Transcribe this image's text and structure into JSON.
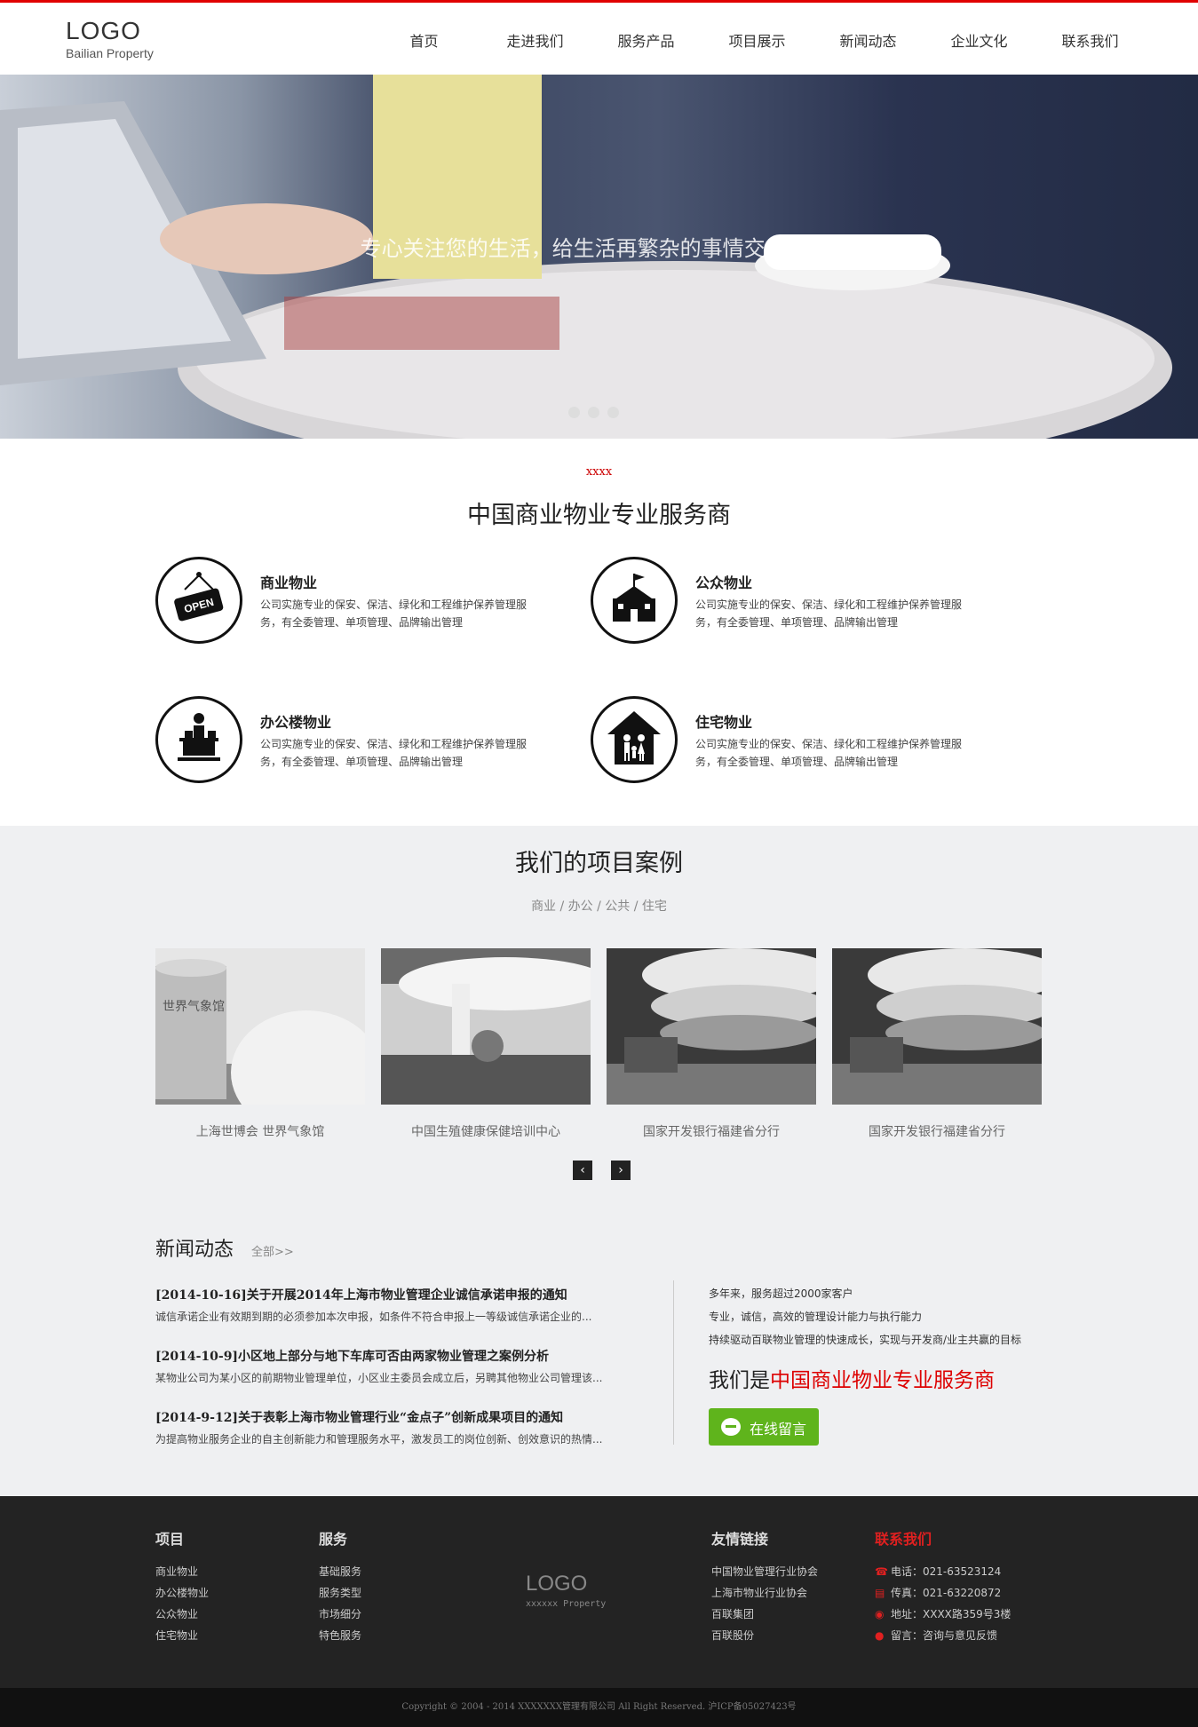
{
  "header": {
    "logo": "LOGO",
    "logo_sub": "Bailian Property",
    "nav": [
      "首页",
      "走进我们",
      "服务产品",
      "项目展示",
      "新闻动态",
      "企业文化",
      "联系我们"
    ]
  },
  "hero": {
    "caption": "专心关注您的生活，给生活再繁杂的事情交给我们!",
    "slide_count": 3
  },
  "intro": {
    "tag": "xxxx",
    "title": "中国商业物业专业服务商"
  },
  "services": [
    {
      "title": "商业物业",
      "desc": "公司实施专业的保安、保洁、绿化和工程维护保养管理服务，有全委管理、单项管理、品牌输出管理",
      "icon": "open-sign-icon"
    },
    {
      "title": "公众物业",
      "desc": "公司实施专业的保安、保洁、绿化和工程维护保养管理服务，有全委管理、单项管理、品牌输出管理",
      "icon": "school-icon"
    },
    {
      "title": "办公楼物业",
      "desc": "公司实施专业的保安、保洁、绿化和工程维护保养管理服务，有全委管理、单项管理、品牌输出管理",
      "icon": "office-desk-icon"
    },
    {
      "title": "住宅物业",
      "desc": "公司实施专业的保安、保洁、绿化和工程维护保养管理服务，有全委管理、单项管理、品牌输出管理",
      "icon": "family-house-icon"
    }
  ],
  "cases": {
    "title": "我们的项目案例",
    "tabs": "商业 / 办公 / 公共 / 住宅",
    "items": [
      {
        "label": "上海世博会 世界气象馆"
      },
      {
        "label": "中国生殖健康保健培训中心"
      },
      {
        "label": "国家开发银行福建省分行"
      },
      {
        "label": "国家开发银行福建省分行"
      }
    ],
    "prev": "‹",
    "next": "›"
  },
  "news": {
    "title": "新闻动态",
    "more": "全部>>",
    "items": [
      {
        "title": "[2014-10-16]关于开展2014年上海市物业管理企业诚信承诺申报的通知",
        "desc": "诚信承诺企业有效期到期的必须参加本次申报，如条件不符合申报上一等级诚信承诺企业的..."
      },
      {
        "title": "[2014-10-9]小区地上部分与地下车库可否由两家物业管理之案例分析",
        "desc": "某物业公司为某小区的前期物业管理单位，小区业主委员会成立后，另聘其他物业公司管理该..."
      },
      {
        "title": "[2014-9-12]关于表彰上海市物业管理行业“金点子”创新成果项目的通知",
        "desc": "为提高物业服务企业的自主创新能力和管理服务水平，激发员工的岗位创新、创效意识的热情..."
      }
    ]
  },
  "about": {
    "lines": [
      "多年来，服务超过2000家客户",
      "专业，诚信，高效的管理设计能力与执行能力",
      "持续驱动百联物业管理的快速成长，实现与开发商/业主共赢的目标"
    ],
    "title_prefix": "我们是",
    "title_highlight": "中国商业物业专业服务商",
    "button": "在线留言"
  },
  "footer": {
    "projects": {
      "title": "项目",
      "items": [
        "商业物业",
        "办公楼物业",
        "公众物业",
        "住宅物业"
      ]
    },
    "services": {
      "title": "服务",
      "items": [
        "基础服务",
        "服务类型",
        "市场细分",
        "特色服务"
      ]
    },
    "logo": "LOGO",
    "logo_sub": "xxxxxx Property",
    "links": {
      "title": "友情链接",
      "items": [
        "中国物业管理行业协会",
        "上海市物业行业协会",
        "百联集团",
        "百联股份"
      ]
    },
    "contact": {
      "title": "联系我们",
      "items": [
        "电话：021-63523124",
        "传真：021-63220872",
        "地址：XXXX路359号3楼",
        "留言：咨询与意见反馈"
      ]
    },
    "copyright": "Copyright © 2004 - 2014 XXXXXXX管理有限公司     All Right Reserved.   沪ICP备05027423号"
  },
  "colors": {
    "accent": "#e00000",
    "button_green": "#5fb41c",
    "footer_bg": "#232323"
  }
}
